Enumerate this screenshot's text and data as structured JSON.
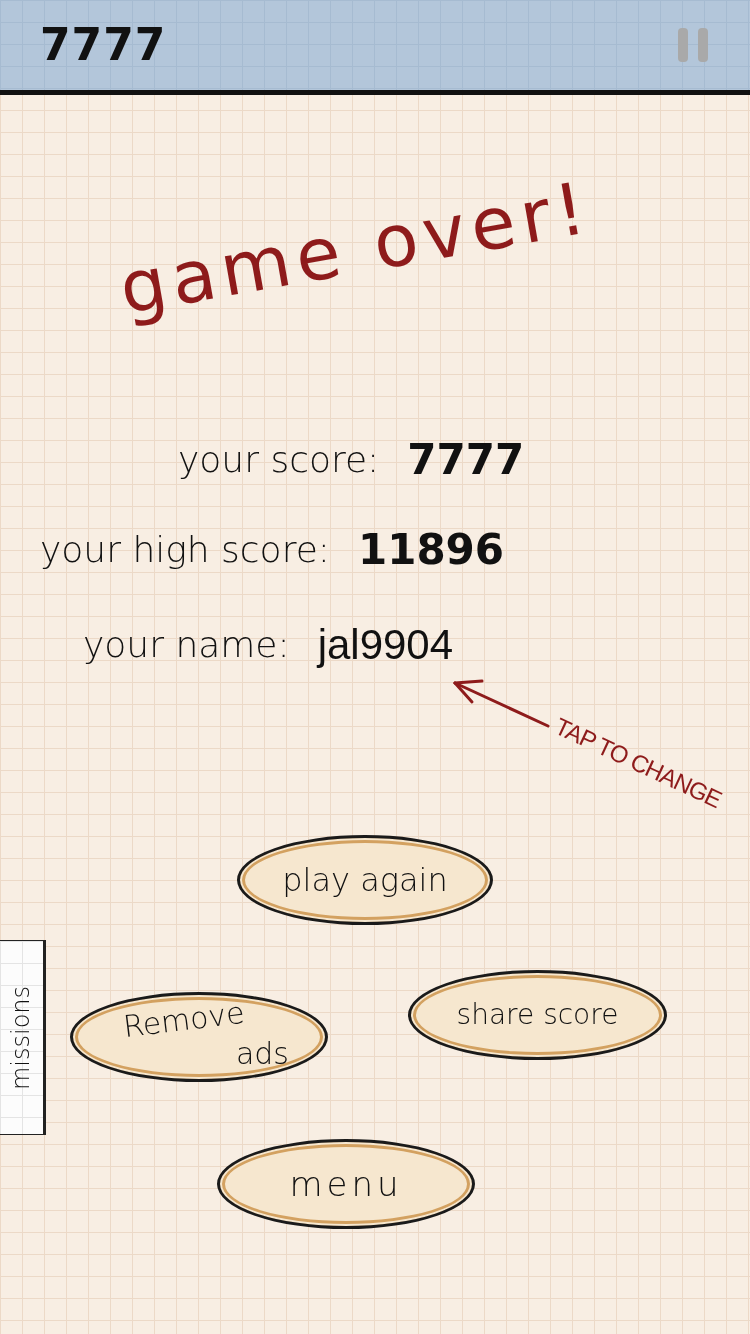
{
  "top_bar": {
    "score": "7777"
  },
  "title": "game over!",
  "stats": [
    {
      "kind": "score",
      "label": "your score:",
      "value": "7777"
    },
    {
      "kind": "score",
      "label": "your high score:",
      "value": "11896"
    },
    {
      "kind": "name",
      "label": "your name:",
      "value": "jal9904"
    }
  ],
  "name_hint": "TAP TO CHANGE",
  "buttons": [
    {
      "lines": [
        "play again"
      ]
    },
    {
      "lines": [
        "Remove",
        "ads"
      ]
    },
    {
      "lines": [
        "share score"
      ]
    },
    {
      "lines": [
        "menu"
      ]
    }
  ],
  "side_tab": {
    "label": "missions"
  }
}
